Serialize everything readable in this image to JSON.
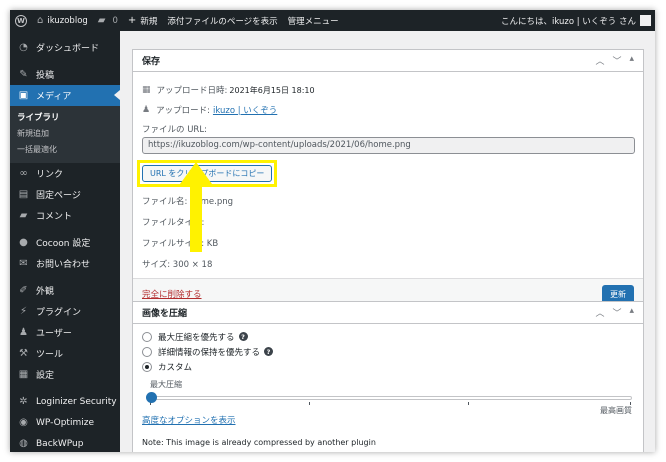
{
  "adminbar": {
    "site_name": "ikuzoblog",
    "comments_count": "0",
    "new_label": "新規",
    "view_attachment": "添付ファイルのページを表示",
    "admin_menu": "管理メニュー",
    "greeting": "こんにちは、ikuzo | いくぞう さん"
  },
  "sidebar": {
    "items": [
      {
        "label": "ダッシュボード",
        "icon": "dashboard-icon",
        "glyph": "◔"
      },
      {
        "label": "投稿",
        "icon": "pin-icon",
        "glyph": "✎"
      },
      {
        "label": "メディア",
        "icon": "media-icon",
        "glyph": "▣"
      },
      {
        "label": "リンク",
        "icon": "link-icon",
        "glyph": "∞"
      },
      {
        "label": "固定ページ",
        "icon": "page-icon",
        "glyph": "▤"
      },
      {
        "label": "コメント",
        "icon": "comment-icon",
        "glyph": "▰"
      },
      {
        "label": "Cocoon 設定",
        "icon": "cocoon-icon",
        "glyph": "●"
      },
      {
        "label": "お問い合わせ",
        "icon": "mail-icon",
        "glyph": "✉"
      },
      {
        "label": "外観",
        "icon": "brush-icon",
        "glyph": "✐"
      },
      {
        "label": "プラグイン",
        "icon": "plugin-icon",
        "glyph": "⚡"
      },
      {
        "label": "ユーザー",
        "icon": "user-icon",
        "glyph": "♟"
      },
      {
        "label": "ツール",
        "icon": "wrench-icon",
        "glyph": "⚒"
      },
      {
        "label": "設定",
        "icon": "settings-icon",
        "glyph": "▦"
      },
      {
        "label": "Loginizer Security",
        "icon": "gear-icon",
        "glyph": "✲"
      },
      {
        "label": "WP-Optimize",
        "icon": "optimize-icon",
        "glyph": "◉"
      },
      {
        "label": "BackWPup",
        "icon": "backup-icon",
        "glyph": "◍"
      }
    ],
    "media_sub": [
      "ライブラリ",
      "新規追加",
      "一括最適化"
    ]
  },
  "save_box": {
    "title": "保存",
    "upload_date_label": "アップロード日時:",
    "upload_date_value": "2021年6月15日 18:10",
    "uploader_label": "アップロード:",
    "uploader_value": "ikuzo | いくぞう",
    "file_url_label": "ファイルの URL:",
    "file_url_value": "https://ikuzoblog.com/wp-content/uploads/2021/06/home.png",
    "copy_button": "URL をクリップボードにコピー",
    "file_name": "ファイル名: home.png",
    "file_type": "ファイルタイプ:",
    "file_size": "ファイルサイズ: KB",
    "dimensions": "サイズ: 300 × 18",
    "delete_link": "完全に削除する",
    "update_button": "更新"
  },
  "compress_box": {
    "title": "画像を圧縮",
    "options": [
      {
        "label": "最大圧縮を優先する",
        "checked": false,
        "help": true
      },
      {
        "label": "詳細情報の保持を優先する",
        "checked": false,
        "help": true
      },
      {
        "label": "カスタム",
        "checked": true,
        "help": false
      }
    ],
    "slider_min_label": "最大圧縮",
    "slider_max_label": "最高画質",
    "slider_value": 0,
    "advanced_link": "高度なオプションを表示",
    "note": "Note: This image is already compressed by another plugin"
  },
  "colors": {
    "accent": "#2271b1",
    "highlight": "#fff200",
    "sidebar_bg": "#1d2327"
  }
}
